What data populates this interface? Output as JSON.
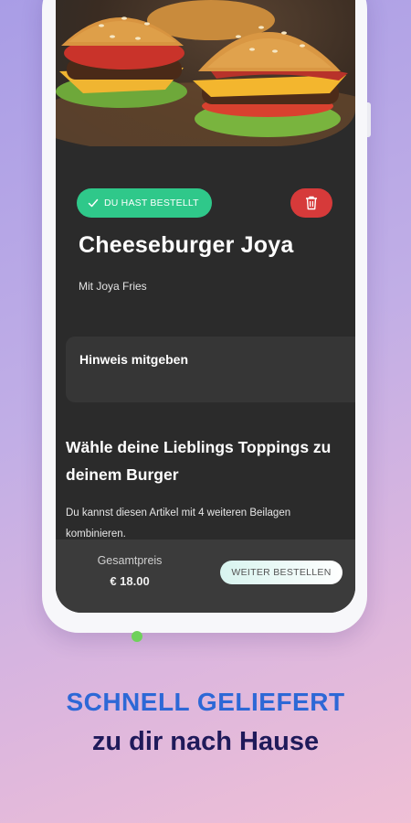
{
  "product": {
    "image_description": "cheeseburger-photo",
    "ordered_badge_label": "DU HAST BESTELLT",
    "name": "Cheeseburger Joya",
    "side": "Mit Joya Fries"
  },
  "note": {
    "label": "Hinweis mitgeben"
  },
  "toppings": {
    "title": "Wähle deine Lieblings Toppings zu deinem Burger",
    "description": "Du kannst diesen Artikel mit 4 weiteren Beilagen kombinieren."
  },
  "footer": {
    "total_label": "Gesamtpreis",
    "total_value": "€ 18.00",
    "continue_label": "WEITER BESTELLEN"
  },
  "promo": {
    "headline": "SCHNELL GELIEFERT",
    "subheadline": "zu dir nach Hause"
  },
  "colors": {
    "badge_green": "#2fc88a",
    "delete_red": "#d63a3a",
    "screen_bg": "#2b2b2b",
    "headline_blue": "#2d68d6",
    "subheadline_navy": "#1f1a5a"
  },
  "icons": {
    "check": "check-icon",
    "delete": "trash-icon"
  }
}
